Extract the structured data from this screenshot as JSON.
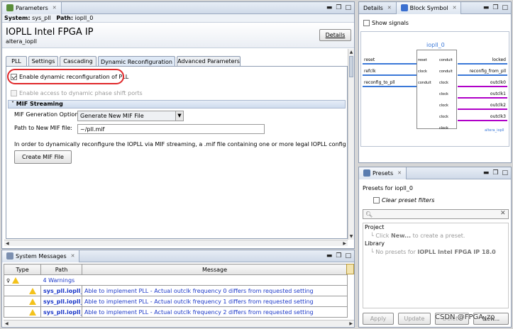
{
  "params": {
    "tab": "Parameters",
    "system_label": "System:",
    "system_value": "sys_pll",
    "path_label": "Path:",
    "path_value": "iopll_0",
    "title": "IOPLL Intel FPGA IP",
    "subtitle": "altera_iopll",
    "details_btn": "Details",
    "tabs": [
      "PLL",
      "Settings",
      "Cascading",
      "Dynamic Reconfiguration",
      "Advanced Parameters"
    ],
    "enable_reconfig": "Enable dynamic reconfiguration of PLL",
    "enable_phase": "Enable access to dynamic phase shift ports",
    "section": "MIF Streaming",
    "mif_gen_label": "MIF Generation Options:",
    "mif_gen_value": "Generate New MIF File",
    "mif_path_label": "Path to New MIF file:",
    "mif_path_value": "~/pll.mif",
    "info_text": "In order to dynamically reconfigure the IOPLL via MIF streaming, a .mif file containing one or more legal IOPLL configurations mu",
    "create_mif": "Create MIF File"
  },
  "messages": {
    "tab": "System Messages",
    "col_type": "Type",
    "col_path": "Path",
    "col_message": "Message",
    "group": "4 Warnings",
    "rows": [
      {
        "path": "sys_pll.iopll_0",
        "msg": "Able to implement PLL - Actual outclk frequency 0 differs from requested setting"
      },
      {
        "path": "sys_pll.iopll_0",
        "msg": "Able to implement PLL - Actual outclk frequency 1 differs from requested setting"
      },
      {
        "path": "sys_pll.iopll_0",
        "msg": "Able to implement PLL - Actual outclk frequency 2 differs from requested setting"
      }
    ]
  },
  "block": {
    "tab_details": "Details",
    "tab_symbol": "Block Symbol",
    "show_signals": "Show signals",
    "instance": "iopll_0",
    "footer": "altera_iopll",
    "left_ports": [
      {
        "outer": "reset",
        "inner": "reset"
      },
      {
        "outer": "refclk",
        "inner": "clock"
      },
      {
        "outer": "reconfig_to_pll",
        "inner": "conduit"
      }
    ],
    "right_ports": [
      {
        "inner": "conduit",
        "outer": "locked"
      },
      {
        "inner": "conduit",
        "outer": "reconfig_from_pll"
      },
      {
        "inner": "clock",
        "outer": "outclk0"
      },
      {
        "inner": "clock",
        "outer": "outclk1"
      },
      {
        "inner": "clock",
        "outer": "outclk2"
      },
      {
        "inner": "clock",
        "outer": "outclk3"
      },
      {
        "inner": "clock",
        "outer": ""
      }
    ]
  },
  "presets": {
    "tab": "Presets",
    "header": "Presets for iopll_0",
    "clear_filters": "Clear preset filters",
    "project": "Project",
    "click_new_pre": "Click ",
    "click_new_bold": "New...",
    "click_new_post": " to create a preset.",
    "library": "Library",
    "no_presets_pre": "No presets for ",
    "no_presets_bold": "IOPLL Intel FPGA IP 18.0",
    "apply": "Apply",
    "update": "Update",
    "delete": "Delete",
    "new": "New..."
  },
  "watermark": "CSDN @FPGA_zo",
  "colors": {
    "accent": "#4a7fd4",
    "pin_magenta": "#b000c8",
    "pin_blue": "#3a78d8",
    "highlight": "#e0282a",
    "link": "#1a37c8"
  }
}
